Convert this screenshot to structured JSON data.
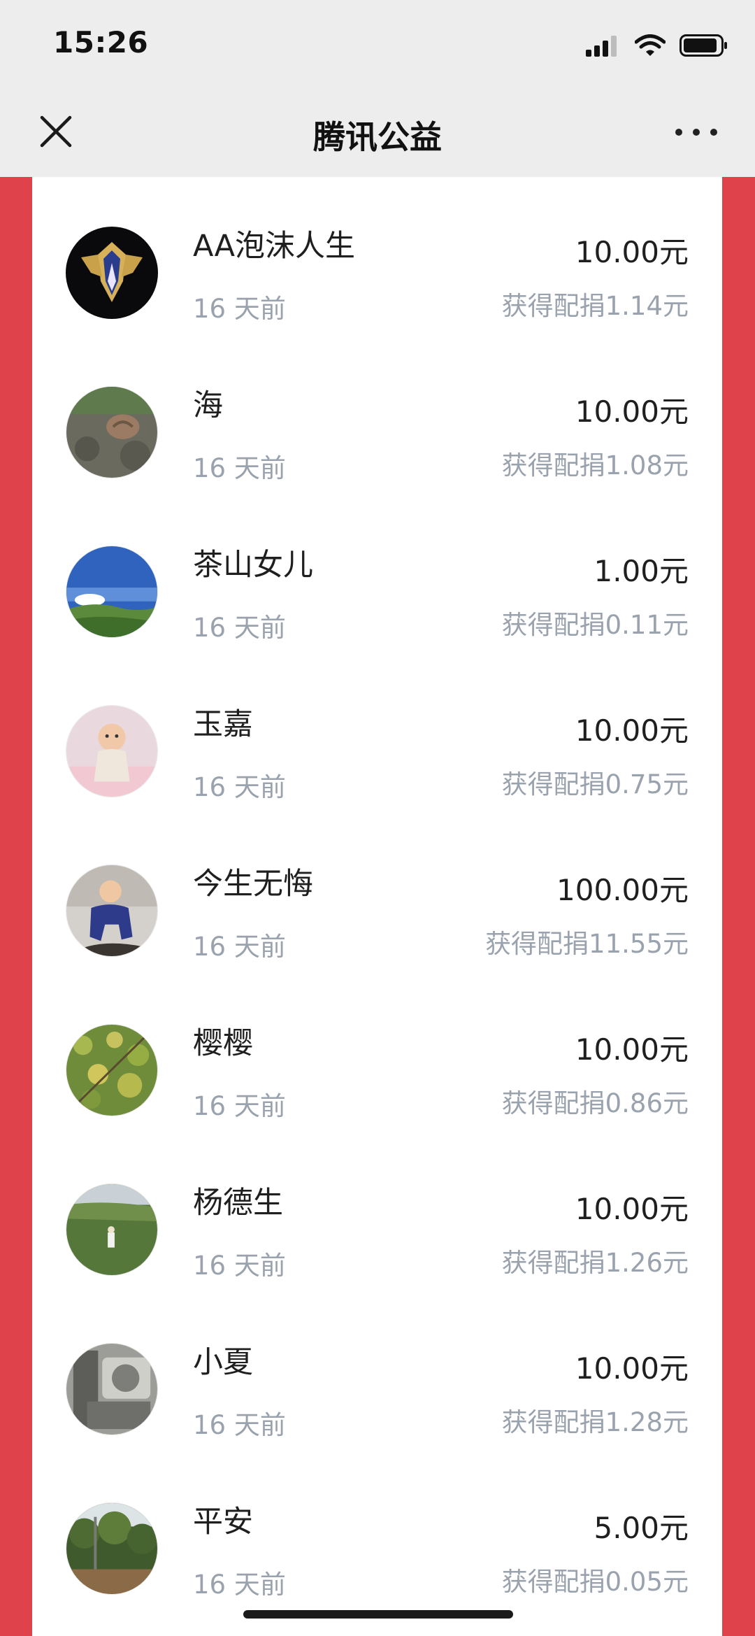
{
  "status_bar": {
    "time": "15:26",
    "icons": [
      "signal-icon",
      "wifi-icon",
      "battery-icon"
    ]
  },
  "nav": {
    "title": "腾讯公益",
    "close_icon": "close-icon",
    "more_icon": "more-icon"
  },
  "colors": {
    "accent_red": "#df424b",
    "secondary_text": "#9aa3ad"
  },
  "donations": [
    {
      "name": "AA泡沫人生",
      "time": "16 天前",
      "amount": "10.00元",
      "match": "获得配捐1.14元",
      "avatar": "emblem"
    },
    {
      "name": "海",
      "time": "16 天前",
      "amount": "10.00元",
      "match": "获得配捐1.08元",
      "avatar": "snail"
    },
    {
      "name": "茶山女儿",
      "time": "16 天前",
      "amount": "1.00元",
      "match": "获得配捐0.11元",
      "avatar": "sky"
    },
    {
      "name": "玉嘉",
      "time": "16 天前",
      "amount": "10.00元",
      "match": "获得配捐0.75元",
      "avatar": "baby"
    },
    {
      "name": "今生无悔",
      "time": "16 天前",
      "amount": "100.00元",
      "match": "获得配捐11.55元",
      "avatar": "child"
    },
    {
      "name": "樱樱",
      "time": "16 天前",
      "amount": "10.00元",
      "match": "获得配捐0.86元",
      "avatar": "tree"
    },
    {
      "name": "杨德生",
      "time": "16 天前",
      "amount": "10.00元",
      "match": "获得配捐1.26元",
      "avatar": "field"
    },
    {
      "name": "小夏",
      "time": "16 天前",
      "amount": "10.00元",
      "match": "获得配捐1.28元",
      "avatar": "machine"
    },
    {
      "name": "平安",
      "time": "16 天前",
      "amount": "5.00元",
      "match": "获得配捐0.05元",
      "avatar": "forest"
    }
  ]
}
